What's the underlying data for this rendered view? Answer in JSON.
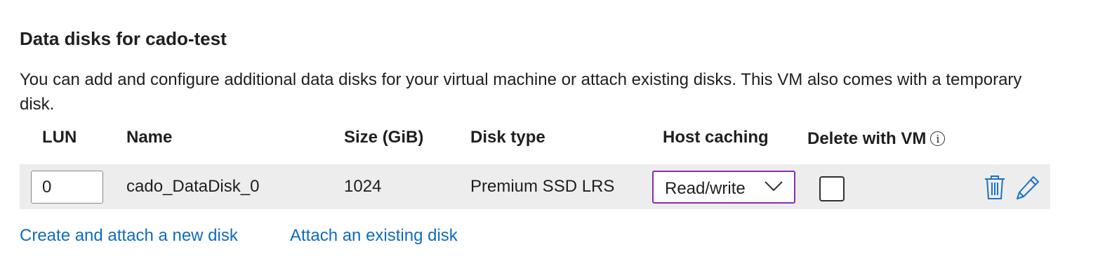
{
  "section": {
    "title": "Data disks for cado-test",
    "description": "You can add and configure additional data disks for your virtual machine or attach existing disks. This VM also comes with a temporary disk."
  },
  "table": {
    "headers": {
      "lun": "LUN",
      "name": "Name",
      "size": "Size (GiB)",
      "disk_type": "Disk type",
      "host_caching": "Host caching",
      "delete_with_vm": "Delete with VM",
      "info_icon": "info-icon"
    },
    "rows": [
      {
        "lun": "0",
        "name": "cado_DataDisk_0",
        "size": "1024",
        "disk_type": "Premium SSD LRS",
        "host_caching": "Read/write",
        "delete_with_vm": false,
        "actions": [
          "delete-icon",
          "edit-icon"
        ]
      }
    ]
  },
  "links": {
    "create_new": "Create and attach a new disk",
    "attach_existing": "Attach an existing disk"
  },
  "colors": {
    "link": "#0f6cbd",
    "select_focus_border": "#8a2bb9",
    "row_background": "#eeeded",
    "icon_blue": "#1a73c8"
  }
}
